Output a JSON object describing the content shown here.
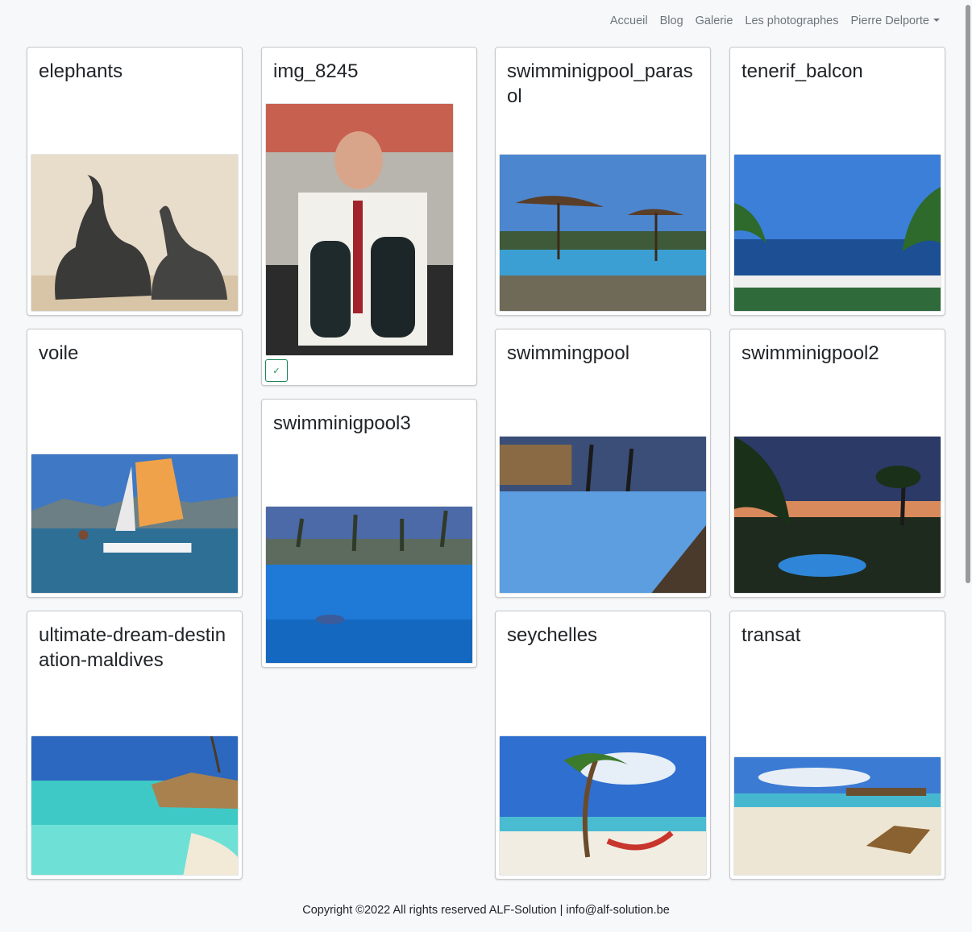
{
  "nav": {
    "items": [
      "Accueil",
      "Blog",
      "Galerie",
      "Les photographes"
    ],
    "user": "Pierre Delporte"
  },
  "gallery": [
    {
      "title": "elephants",
      "image": "elephant-sculptures-photo"
    },
    {
      "title": "voile",
      "image": "catamaran-sailing-photo"
    },
    {
      "title": "ultimate-dream-destination-maldives",
      "image": "maldives-overwater-bungalows-photo"
    },
    {
      "title": "img_8245",
      "image": "man-holding-champagne-bottles-photo",
      "action": "✓"
    },
    {
      "title": "swimminigpool3",
      "image": "hotel-pool-dusk-photo"
    },
    {
      "title": "swimminigpool_parasol",
      "image": "pool-with-parasols-photo"
    },
    {
      "title": "swimmingpool",
      "image": "pool-night-photo"
    },
    {
      "title": "seychelles",
      "image": "beach-palm-hammock-photo"
    },
    {
      "title": "tenerif_balcon",
      "image": "balcony-sea-view-photo"
    },
    {
      "title": "swimminigpool2",
      "image": "pool-sunset-photo"
    },
    {
      "title": "transat",
      "image": "beach-lounger-photo"
    }
  ],
  "footer": "Copyright ©2022 All rights reserved ALF-Solution | info@alf-solution.be"
}
